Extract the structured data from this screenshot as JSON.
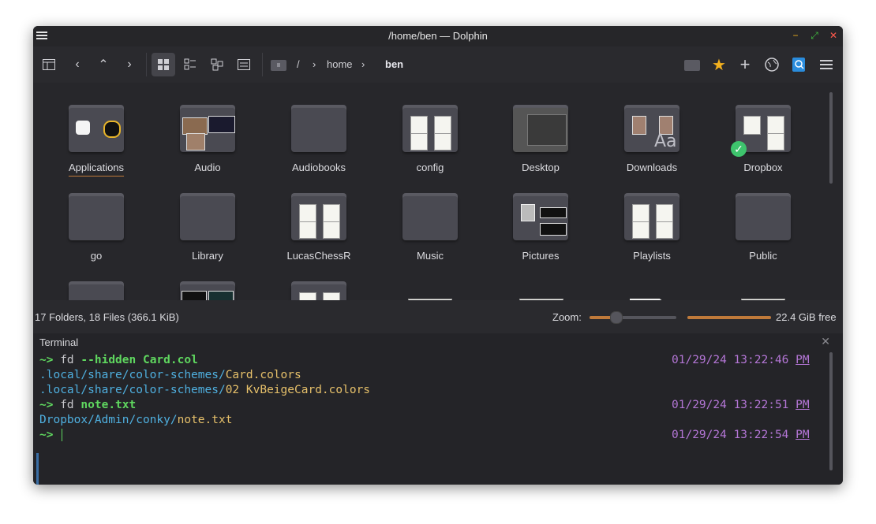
{
  "window": {
    "title": "/home/ben — Dolphin"
  },
  "toolbar": {
    "breadcrumb": {
      "root": "/",
      "home": "home",
      "current": "ben"
    }
  },
  "files": [
    {
      "name": "Applications"
    },
    {
      "name": "Audio"
    },
    {
      "name": "Audiobooks"
    },
    {
      "name": "config"
    },
    {
      "name": "Desktop"
    },
    {
      "name": "Downloads"
    },
    {
      "name": "Dropbox"
    },
    {
      "name": "go"
    },
    {
      "name": "Library"
    },
    {
      "name": "LucasChessR"
    },
    {
      "name": "Music"
    },
    {
      "name": "Pictures"
    },
    {
      "name": "Playlists"
    },
    {
      "name": "Public"
    }
  ],
  "status": {
    "summary": "17 Folders, 18 Files (366.1 KiB)",
    "zoom_label": "Zoom:",
    "free_space": "22.4 GiB free",
    "zoom_level": 0.3,
    "disk_used_fraction": 1.0
  },
  "terminal": {
    "header": "Terminal",
    "prompt": "~>",
    "lines": [
      {
        "cmd": "fd",
        "arg": "--hidden Card.col",
        "time": "01/29/24 13:22:46",
        "ampm": "PM"
      },
      {
        "out_dir": ".local/share/color-schemes/",
        "out_file": "Card.colors"
      },
      {
        "out_dir": ".local/share/color-schemes/",
        "out_file": "02 KvBeigeCard.colors"
      },
      {
        "cmd": "fd",
        "arg": "note.txt",
        "time": "01/29/24 13:22:51",
        "ampm": "PM"
      },
      {
        "out_dir": "Dropbox/Admin/conky/",
        "out_file": "note.txt"
      },
      {
        "prompt_only": true,
        "time": "01/29/24 13:22:54",
        "ampm": "PM"
      }
    ]
  },
  "colors": {
    "accent": "#c07a3a",
    "prompt": "#5fd75f",
    "path": "#4fb0e0",
    "time": "#b476d6",
    "star": "#f2b01e"
  }
}
